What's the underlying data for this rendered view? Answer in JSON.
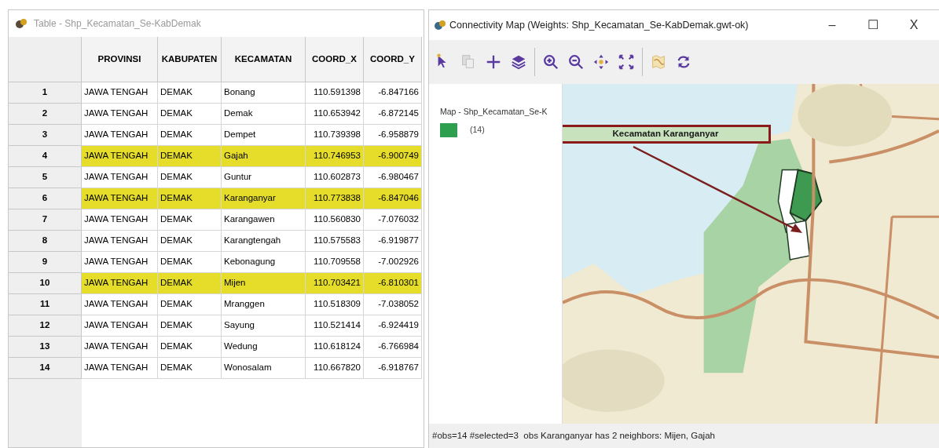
{
  "table_window": {
    "title": "Table - Shp_Kecamatan_Se-KabDemak",
    "columns": [
      "PROVINSI",
      "KABUPATEN",
      "KECAMATAN",
      "COORD_X",
      "COORD_Y"
    ],
    "rows": [
      {
        "index": "1",
        "cells": [
          "JAWA TENGAH",
          "DEMAK",
          "Bonang",
          "110.591398",
          "-6.847166"
        ],
        "selected": false
      },
      {
        "index": "2",
        "cells": [
          "JAWA TENGAH",
          "DEMAK",
          "Demak",
          "110.653942",
          "-6.872145"
        ],
        "selected": false
      },
      {
        "index": "3",
        "cells": [
          "JAWA TENGAH",
          "DEMAK",
          "Dempet",
          "110.739398",
          "-6.958879"
        ],
        "selected": false
      },
      {
        "index": "4",
        "cells": [
          "JAWA TENGAH",
          "DEMAK",
          "Gajah",
          "110.746953",
          "-6.900749"
        ],
        "selected": true
      },
      {
        "index": "5",
        "cells": [
          "JAWA TENGAH",
          "DEMAK",
          "Guntur",
          "110.602873",
          "-6.980467"
        ],
        "selected": false
      },
      {
        "index": "6",
        "cells": [
          "JAWA TENGAH",
          "DEMAK",
          "Karanganyar",
          "110.773838",
          "-6.847046"
        ],
        "selected": true
      },
      {
        "index": "7",
        "cells": [
          "JAWA TENGAH",
          "DEMAK",
          "Karangawen",
          "110.560830",
          "-7.076032"
        ],
        "selected": false
      },
      {
        "index": "8",
        "cells": [
          "JAWA TENGAH",
          "DEMAK",
          "Karangtengah",
          "110.575583",
          "-6.919877"
        ],
        "selected": false
      },
      {
        "index": "9",
        "cells": [
          "JAWA TENGAH",
          "DEMAK",
          "Kebonagung",
          "110.709558",
          "-7.002926"
        ],
        "selected": false
      },
      {
        "index": "10",
        "cells": [
          "JAWA TENGAH",
          "DEMAK",
          "Mijen",
          "110.703421",
          "-6.810301"
        ],
        "selected": true
      },
      {
        "index": "11",
        "cells": [
          "JAWA TENGAH",
          "DEMAK",
          "Mranggen",
          "110.518309",
          "-7.038052"
        ],
        "selected": false
      },
      {
        "index": "12",
        "cells": [
          "JAWA TENGAH",
          "DEMAK",
          "Sayung",
          "110.521414",
          "-6.924419"
        ],
        "selected": false
      },
      {
        "index": "13",
        "cells": [
          "JAWA TENGAH",
          "DEMAK",
          "Wedung",
          "110.618124",
          "-6.766984"
        ],
        "selected": false
      },
      {
        "index": "14",
        "cells": [
          "JAWA TENGAH",
          "DEMAK",
          "Wonosalam",
          "110.667820",
          "-6.918767"
        ],
        "selected": false
      }
    ]
  },
  "map_window": {
    "title": "Connectivity Map (Weights: Shp_Kecamatan_Se-KabDemak.gwt-ok)",
    "window_buttons": [
      "–",
      "☐",
      "X"
    ],
    "toolbar": [
      {
        "kind": "select"
      },
      {
        "kind": "copy"
      },
      {
        "kind": "plus"
      },
      {
        "kind": "layers"
      },
      {
        "kind": "sep"
      },
      {
        "kind": "zoomin"
      },
      {
        "kind": "zoomout"
      },
      {
        "kind": "pan"
      },
      {
        "kind": "fit"
      },
      {
        "kind": "sep"
      },
      {
        "kind": "basemap"
      },
      {
        "kind": "refresh"
      }
    ],
    "legend": {
      "title": "Map - Shp_Kecamatan_Se-K",
      "items": [
        {
          "label": "(14)",
          "color": "#2e9e4f"
        }
      ]
    },
    "callout": "Kecamatan Karanganyar",
    "status_bar": "#obs=14 #selected=3  obs Karanganyar has 2 neighbors: Mijen, Gajah"
  }
}
